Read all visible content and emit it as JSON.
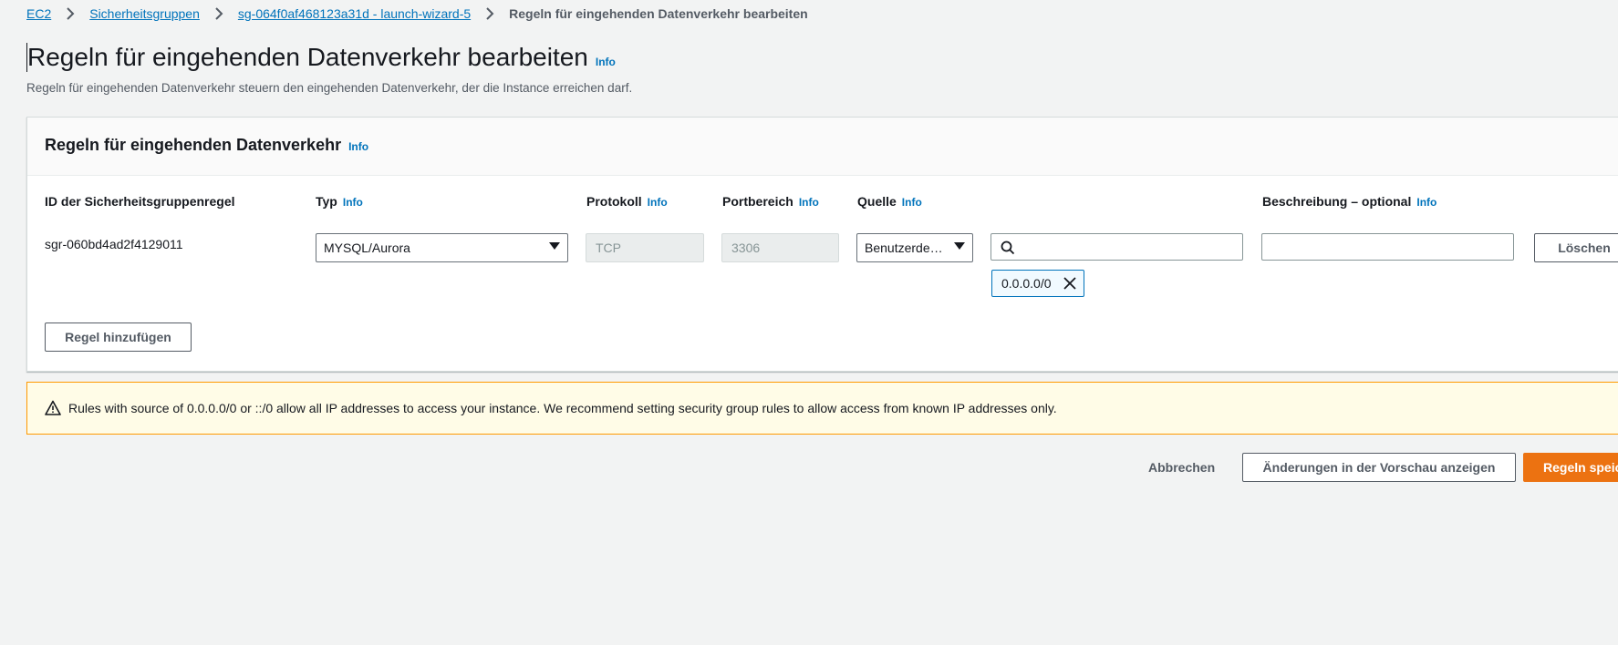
{
  "breadcrumb": {
    "items": [
      "EC2",
      "Sicherheitsgruppen",
      "sg-064f0af468123a31d - launch-wizard-5"
    ],
    "current": "Regeln für eingehenden Datenverkehr bearbeiten"
  },
  "header": {
    "title": "Regeln für eingehenden Datenverkehr bearbeiten",
    "info": "Info",
    "description": "Regeln für eingehenden Datenverkehr steuern den eingehenden Datenverkehr, der die Instance erreichen darf."
  },
  "rules_panel": {
    "title": "Regeln für eingehenden Datenverkehr",
    "info": "Info",
    "columns": {
      "rule_id": "ID der Sicherheitsgruppenregel",
      "type": "Typ",
      "protocol": "Protokoll",
      "port_range": "Portbereich",
      "source": "Quelle",
      "description": "Beschreibung – optional",
      "info": "Info"
    },
    "rule": {
      "id": "sgr-060bd4ad2f4129011",
      "type": "MYSQL/Aurora",
      "protocol": "TCP",
      "port_range": "3306",
      "source_type": "Benutzerde…",
      "source_search": "",
      "source_token": "0.0.0.0/0",
      "description": "",
      "delete_label": "Löschen"
    },
    "add_rule_label": "Regel hinzufügen"
  },
  "warning": {
    "text": "Rules with source of 0.0.0.0/0 or ::/0 allow all IP addresses to access your instance. We recommend setting security group rules to allow access from known IP addresses only.",
    "icon": "warning-icon"
  },
  "footer": {
    "cancel_label": "Abbrechen",
    "preview_label": "Änderungen in der Vorschau anzeigen",
    "save_label": "Regeln speichern"
  },
  "colors": {
    "link": "#0073bb",
    "primary": "#ec7211",
    "warning_border": "#ff9900",
    "warning_bg": "#fffce7"
  }
}
